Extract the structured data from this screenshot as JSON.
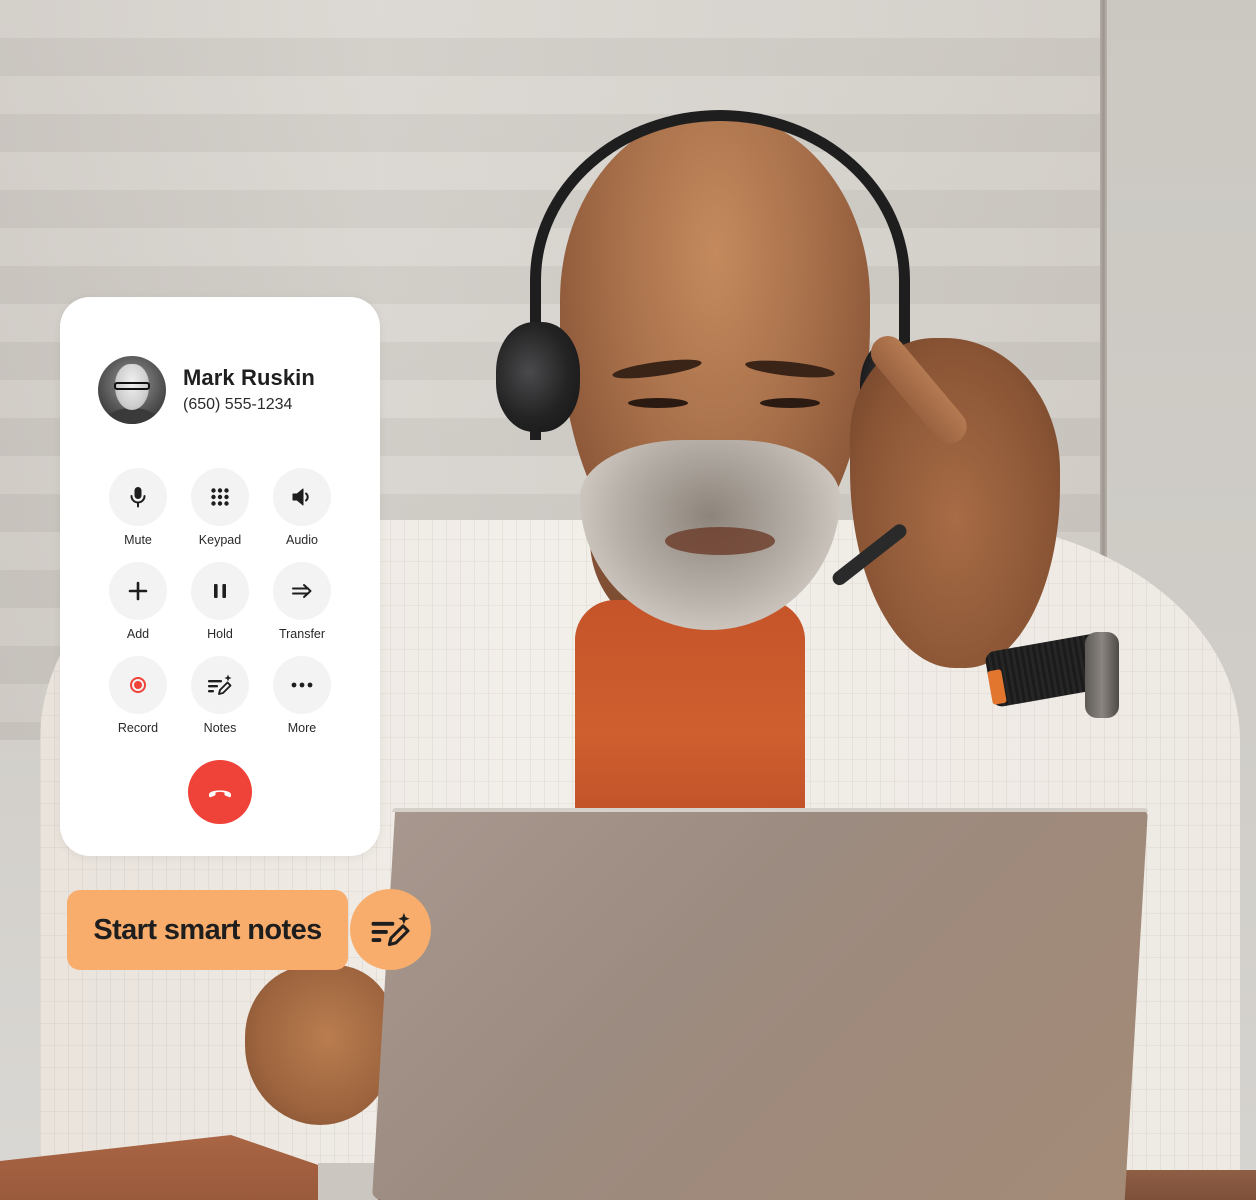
{
  "contact": {
    "name": "Mark Ruskin",
    "phone": "(650) 555-1234",
    "avatar": "contact-photo"
  },
  "controls": [
    {
      "label": "Mute",
      "icon": "microphone-icon"
    },
    {
      "label": "Keypad",
      "icon": "keypad-icon"
    },
    {
      "label": "Audio",
      "icon": "speaker-icon"
    },
    {
      "label": "Add",
      "icon": "plus-icon"
    },
    {
      "label": "Hold",
      "icon": "pause-icon"
    },
    {
      "label": "Transfer",
      "icon": "transfer-arrow-icon"
    },
    {
      "label": "Record",
      "icon": "record-icon"
    },
    {
      "label": "Notes",
      "icon": "smart-notes-icon"
    },
    {
      "label": "More",
      "icon": "more-dots-icon"
    }
  ],
  "hangup": {
    "icon": "hang-up-phone-icon",
    "color": "#ef4238"
  },
  "smart_notes": {
    "label": "Start smart notes",
    "icon": "smart-notes-icon",
    "color": "#f8ad6c"
  },
  "colors": {
    "card_bg": "#ffffff",
    "control_bg": "#f3f3f3",
    "record_accent": "#ef4238",
    "text": "#1f1f1f"
  }
}
